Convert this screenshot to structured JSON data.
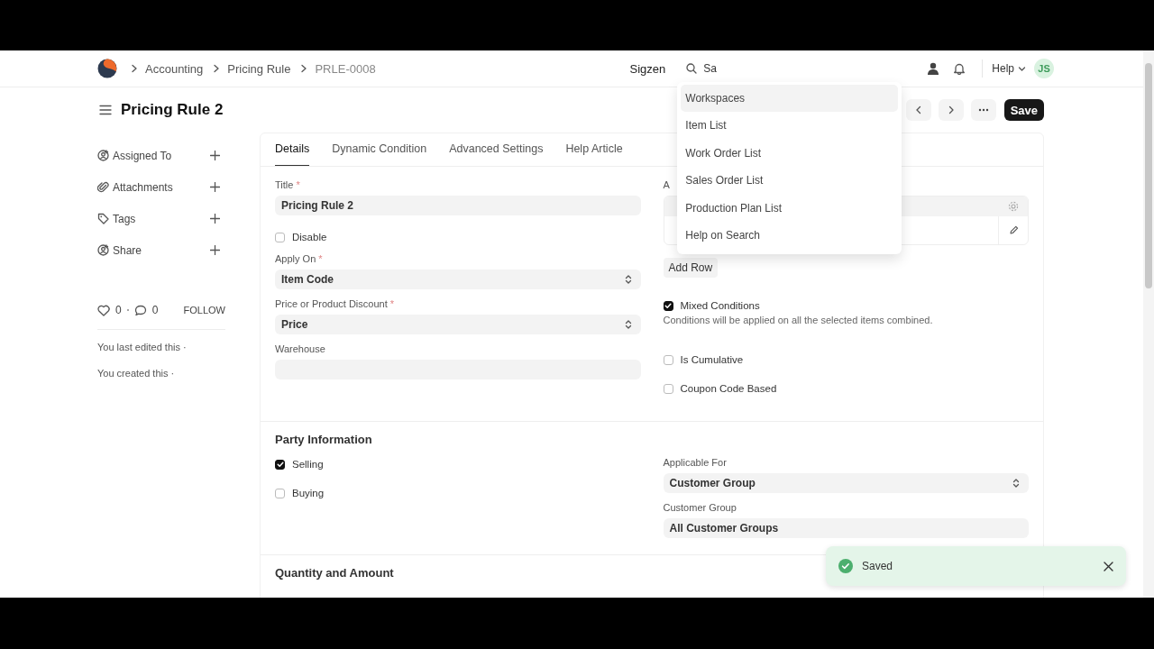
{
  "navbar": {
    "breadcrumbs": [
      "Accounting",
      "Pricing Rule",
      "PRLE-0008"
    ],
    "company": "Sigzen",
    "search": {
      "value": "Sa"
    },
    "help": "Help",
    "avatar": "JS"
  },
  "search_results": [
    {
      "label": "Workspaces",
      "selected": true
    },
    {
      "label": "Item List",
      "selected": false
    },
    {
      "label": "Work Order List",
      "selected": false
    },
    {
      "label": "Sales Order List",
      "selected": false
    },
    {
      "label": "Production Plan List",
      "selected": false
    },
    {
      "label": "Help on Search",
      "selected": false
    }
  ],
  "page": {
    "title": "Pricing Rule 2",
    "save": "Save"
  },
  "sidebar": {
    "actions": [
      "Assigned To",
      "Attachments",
      "Tags",
      "Share"
    ],
    "likes": "0",
    "comments": "0",
    "follow": "FOLLOW",
    "activity": [
      "You last edited this ·",
      "You created this ·"
    ]
  },
  "tabs": [
    {
      "label": "Details",
      "selected": true
    },
    {
      "label": "Dynamic Condition",
      "selected": false
    },
    {
      "label": "Advanced Settings",
      "selected": false
    },
    {
      "label": "Help Article",
      "selected": false
    }
  ],
  "details": {
    "left": [
      {
        "kind": "input",
        "label": "Title",
        "required_mark": "*",
        "value": "Pricing Rule 2"
      },
      {
        "kind": "checkbox",
        "label": "Disable",
        "checked": false
      },
      {
        "kind": "select",
        "label": "Apply On",
        "required_mark": "*",
        "value": "Item Code"
      },
      {
        "kind": "select",
        "label": "Price or Product Discount",
        "required_mark": "*",
        "value": "Price"
      },
      {
        "kind": "input",
        "label": "Warehouse"
      }
    ],
    "right": [
      {
        "kind": "table",
        "label": "A"
      },
      {
        "kind": "button",
        "label": "Add Row"
      },
      {
        "kind": "checkbox",
        "label": "Mixed Conditions",
        "checked": true
      },
      {
        "kind": "note",
        "label": "Conditions will be applied on all the selected items combined."
      },
      {
        "kind": "checkbox",
        "label": "Is Cumulative",
        "checked": false
      },
      {
        "kind": "checkbox",
        "label": "Coupon Code Based",
        "checked": false
      }
    ]
  },
  "party": {
    "title": "Party Information",
    "left": [
      {
        "kind": "checkbox",
        "label": "Selling",
        "checked": true
      },
      {
        "kind": "checkbox",
        "label": "Buying",
        "checked": false
      }
    ],
    "right": [
      {
        "kind": "select",
        "label": "Applicable For",
        "value": "Customer Group"
      },
      {
        "kind": "input",
        "label": "Customer Group",
        "value": "All Customer Groups"
      }
    ]
  },
  "next_section": {
    "title": "Quantity and Amount"
  },
  "toast": {
    "message": "Saved"
  }
}
